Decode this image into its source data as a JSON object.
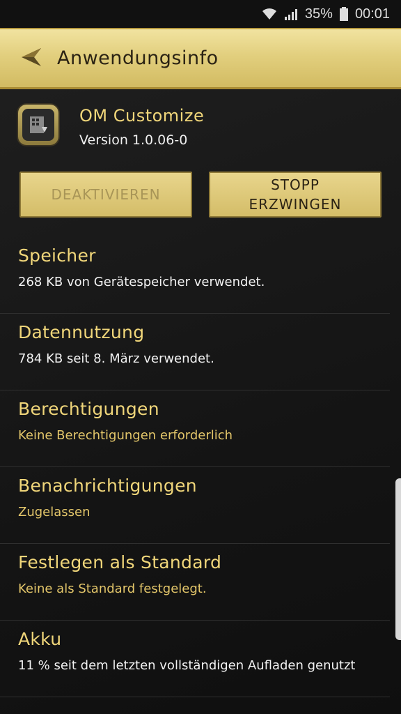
{
  "status_bar": {
    "battery": "35%",
    "time": "00:01"
  },
  "header": {
    "title": "Anwendungsinfo"
  },
  "app": {
    "name": "OM Customize",
    "version": "Version 1.0.06-0"
  },
  "buttons": {
    "disable": "DEAKTIVIEREN",
    "force_stop_line1": "STOPP",
    "force_stop_line2": "ERZWINGEN"
  },
  "items": [
    {
      "title": "Speicher",
      "subtitle": "268 KB von Gerätespeicher verwendet."
    },
    {
      "title": "Datennutzung",
      "subtitle": "784 KB seit 8. März verwendet."
    },
    {
      "title": "Berechtigungen",
      "subtitle": "Keine Berechtigungen erforderlich"
    },
    {
      "title": "Benachrichtigungen",
      "subtitle": "Zugelassen"
    },
    {
      "title": "Festlegen als Standard",
      "subtitle": "Keine als Standard festgelegt."
    },
    {
      "title": "Akku",
      "subtitle": "11 % seit dem letzten vollständigen Aufladen genutzt"
    }
  ],
  "colors": {
    "accent_gold": "#f0d67a",
    "header_gold": "#e2cf7e",
    "background": "#161616"
  }
}
